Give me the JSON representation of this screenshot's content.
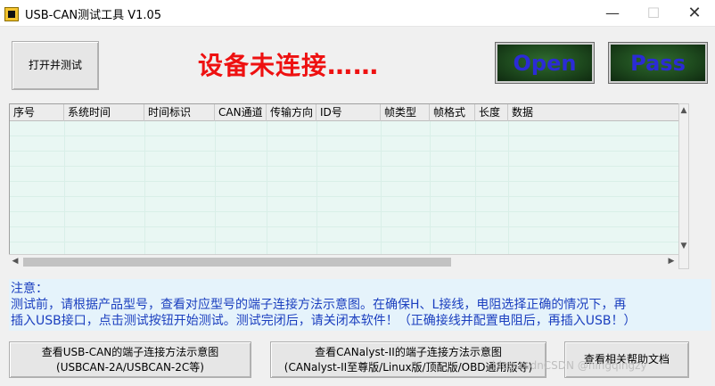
{
  "window": {
    "title": "USB-CAN测试工具 V1.05",
    "min_glyph": "—",
    "max_glyph": "☐",
    "close_glyph": "✕"
  },
  "toolbar": {
    "open_test_label": "打开并测试",
    "status_text": "设备未连接……",
    "status_color": "#ee1111",
    "open_indicator_label": "Open",
    "pass_indicator_label": "Pass"
  },
  "table": {
    "columns": [
      "序号",
      "系统时间",
      "时间标识",
      "CAN通道",
      "传输方向",
      "ID号",
      "帧类型",
      "帧格式",
      "长度",
      "数据"
    ],
    "rows": []
  },
  "notes": {
    "title": "注意：",
    "line1": "测试前，请根据产品型号，查看对应型号的端子连接方法示意图。在确保H、L接线，电阻选择正确的情况下，再",
    "line2": "插入USB接口，点击测试按钮开始测试。测试完闭后，请关闭本软件！（正确接线并配置电阻后，再插入USB！）",
    "text_color": "#1b3fbf"
  },
  "bottom_buttons": {
    "usbcan_line1": "查看USB-CAN的端子连接方法示意图",
    "usbcan_line2": "(USBCAN-2A/USBCAN-2C等)",
    "canalyst_line1": "查看CANalyst-II的端子连接方法示意图",
    "canalyst_line2": "(CANalyst-II至尊版/Linux版/顶配版/OBD通用版等)",
    "help_label": "查看相关帮助文档"
  },
  "watermark": "blog.csdnCSDN @ningqingzy"
}
